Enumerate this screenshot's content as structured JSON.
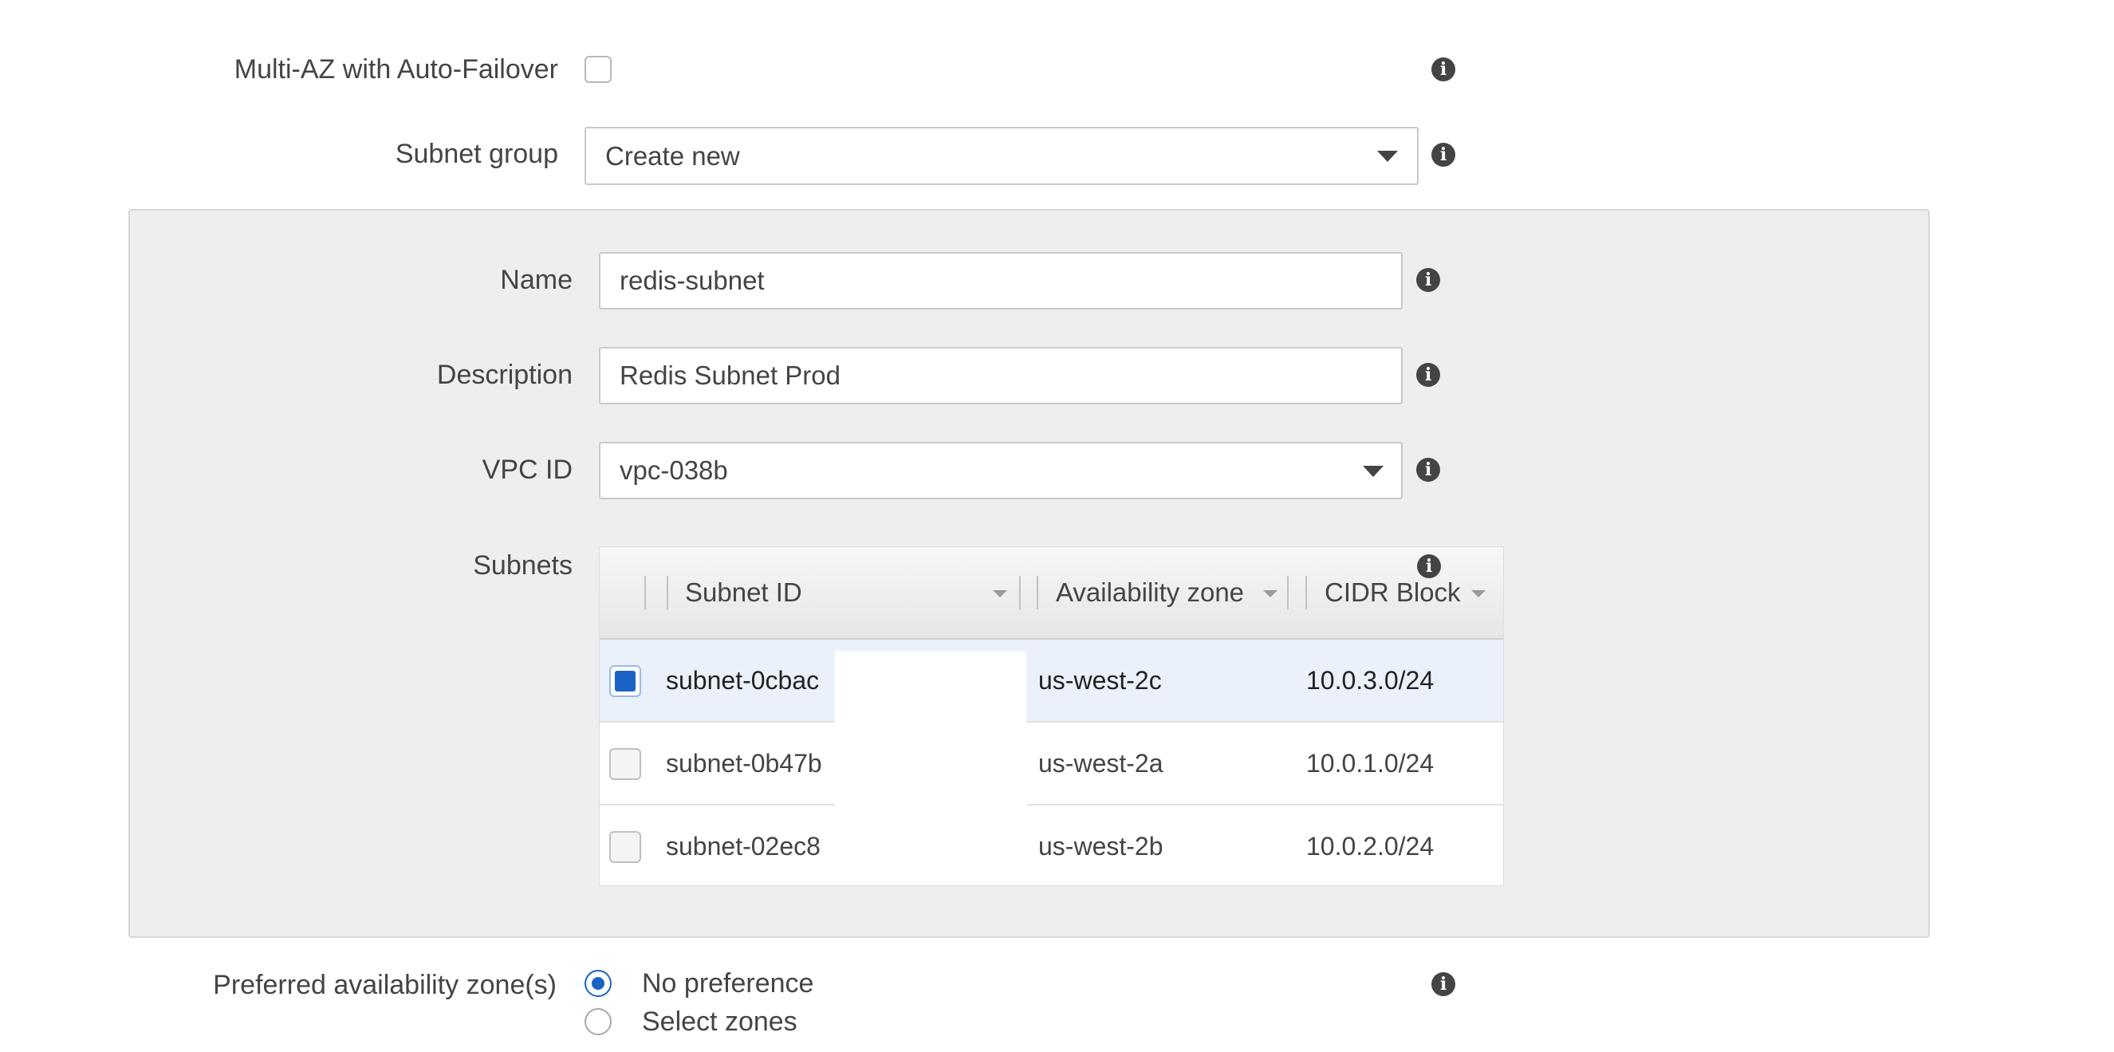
{
  "multi_az": {
    "label": "Multi-AZ with Auto-Failover",
    "checked": false,
    "info_icon": "info-icon"
  },
  "subnet_group": {
    "label": "Subnet group",
    "value": "Create new"
  },
  "name": {
    "label": "Name",
    "value": "redis-subnet"
  },
  "description": {
    "label": "Description",
    "value": "Redis Subnet Prod"
  },
  "vpc": {
    "label": "VPC ID",
    "value": "vpc-038b"
  },
  "subnets": {
    "label": "Subnets",
    "columns": [
      "Subnet ID",
      "Availability zone",
      "CIDR Block"
    ],
    "rows": [
      {
        "subnet_id": "subnet-0cbac",
        "az": "us-west-2c",
        "cidr": "10.0.3.0/24",
        "checked": true
      },
      {
        "subnet_id": "subnet-0b47b",
        "az": "us-west-2a",
        "cidr": "10.0.1.0/24",
        "checked": false
      },
      {
        "subnet_id": "subnet-02ec8",
        "az": "us-west-2b",
        "cidr": "10.0.2.0/24",
        "checked": false
      }
    ]
  },
  "preferred_az": {
    "label": "Preferred availability zone(s)",
    "options": [
      "No preference",
      "Select zones"
    ],
    "selected": "No preference"
  },
  "colors": {
    "accent": "#1a63c5",
    "selected_row": "#eaf1fb",
    "panel": "#eeeeee",
    "text": "#444444"
  }
}
